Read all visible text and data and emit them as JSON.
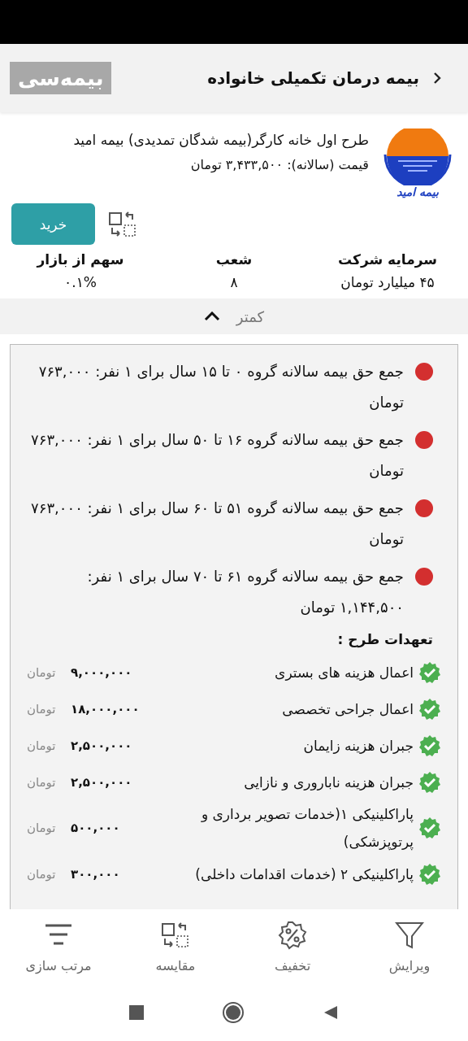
{
  "header": {
    "title": "بیمه درمان تکمیلی خانواده",
    "logo": "بیمه‌سی"
  },
  "plan": {
    "insurer_logo_text": "بیمه امید",
    "name": "طرح اول خانه کارگر(بیمه شدگان تمدیدی) بیمه امید",
    "price": "قیمت (سالانه): ۳,۴۳۳,۵۰۰ تومان",
    "buy_button": "خرید"
  },
  "stats": [
    {
      "label": "سرمایه شرکت",
      "value": "۴۵ میلیارد تومان"
    },
    {
      "label": "شعب",
      "value": "۸"
    },
    {
      "label": "سهم از بازار",
      "value": "۰.۱%"
    }
  ],
  "collapse": {
    "label": "کمتر",
    "expanded": true
  },
  "premiums": [
    {
      "text": "جمع حق بیمه سالانه گروه ۰ تا ۱۵ سال برای ۱ نفر: ۷۶۳,۰۰۰ تومان",
      "color": "#d32f2f"
    },
    {
      "text": "جمع حق بیمه سالانه گروه ۱۶ تا ۵۰ سال برای ۱ نفر: ۷۶۳,۰۰۰ تومان",
      "color": "#d32f2f"
    },
    {
      "text": "جمع حق بیمه سالانه گروه ۵۱ تا ۶۰ سال برای ۱ نفر: ۷۶۳,۰۰۰ تومان",
      "color": "#d32f2f"
    },
    {
      "text": "جمع حق بیمه سالانه گروه ۶۱ تا ۷۰ سال برای ۱ نفر: ۱,۱۴۴,۵۰۰ تومان",
      "color": "#d32f2f"
    }
  ],
  "benefits_title": "تعهدات طرح :",
  "benefits": [
    {
      "label": "اعمال هزینه های بستری",
      "amount": "۹,۰۰۰,۰۰۰",
      "unit": "تومان"
    },
    {
      "label": "اعمال جراحی تخصصی",
      "amount": "۱۸,۰۰۰,۰۰۰",
      "unit": "تومان"
    },
    {
      "label": "جبران هزینه زایمان",
      "amount": "۲,۵۰۰,۰۰۰",
      "unit": "تومان"
    },
    {
      "label": "جبران هزینه ناباروری و نازایی",
      "amount": "۲,۵۰۰,۰۰۰",
      "unit": "تومان"
    },
    {
      "label": "پاراکلینیکی ۱(خدمات تصویر برداری و پرتوپزشکی)",
      "amount": "۵۰۰,۰۰۰",
      "unit": "تومان"
    },
    {
      "label": "پاراکلینیکی ۲ (خدمات اقدامات داخلی)",
      "amount": "۳۰۰,۰۰۰",
      "unit": "تومان"
    }
  ],
  "bottom_nav": [
    {
      "kind": "filter",
      "label": "ویرایش"
    },
    {
      "kind": "discount",
      "label": "تخفیف"
    },
    {
      "kind": "compare",
      "label": "مقایسه"
    },
    {
      "kind": "sort",
      "label": "مرتب سازی"
    }
  ]
}
